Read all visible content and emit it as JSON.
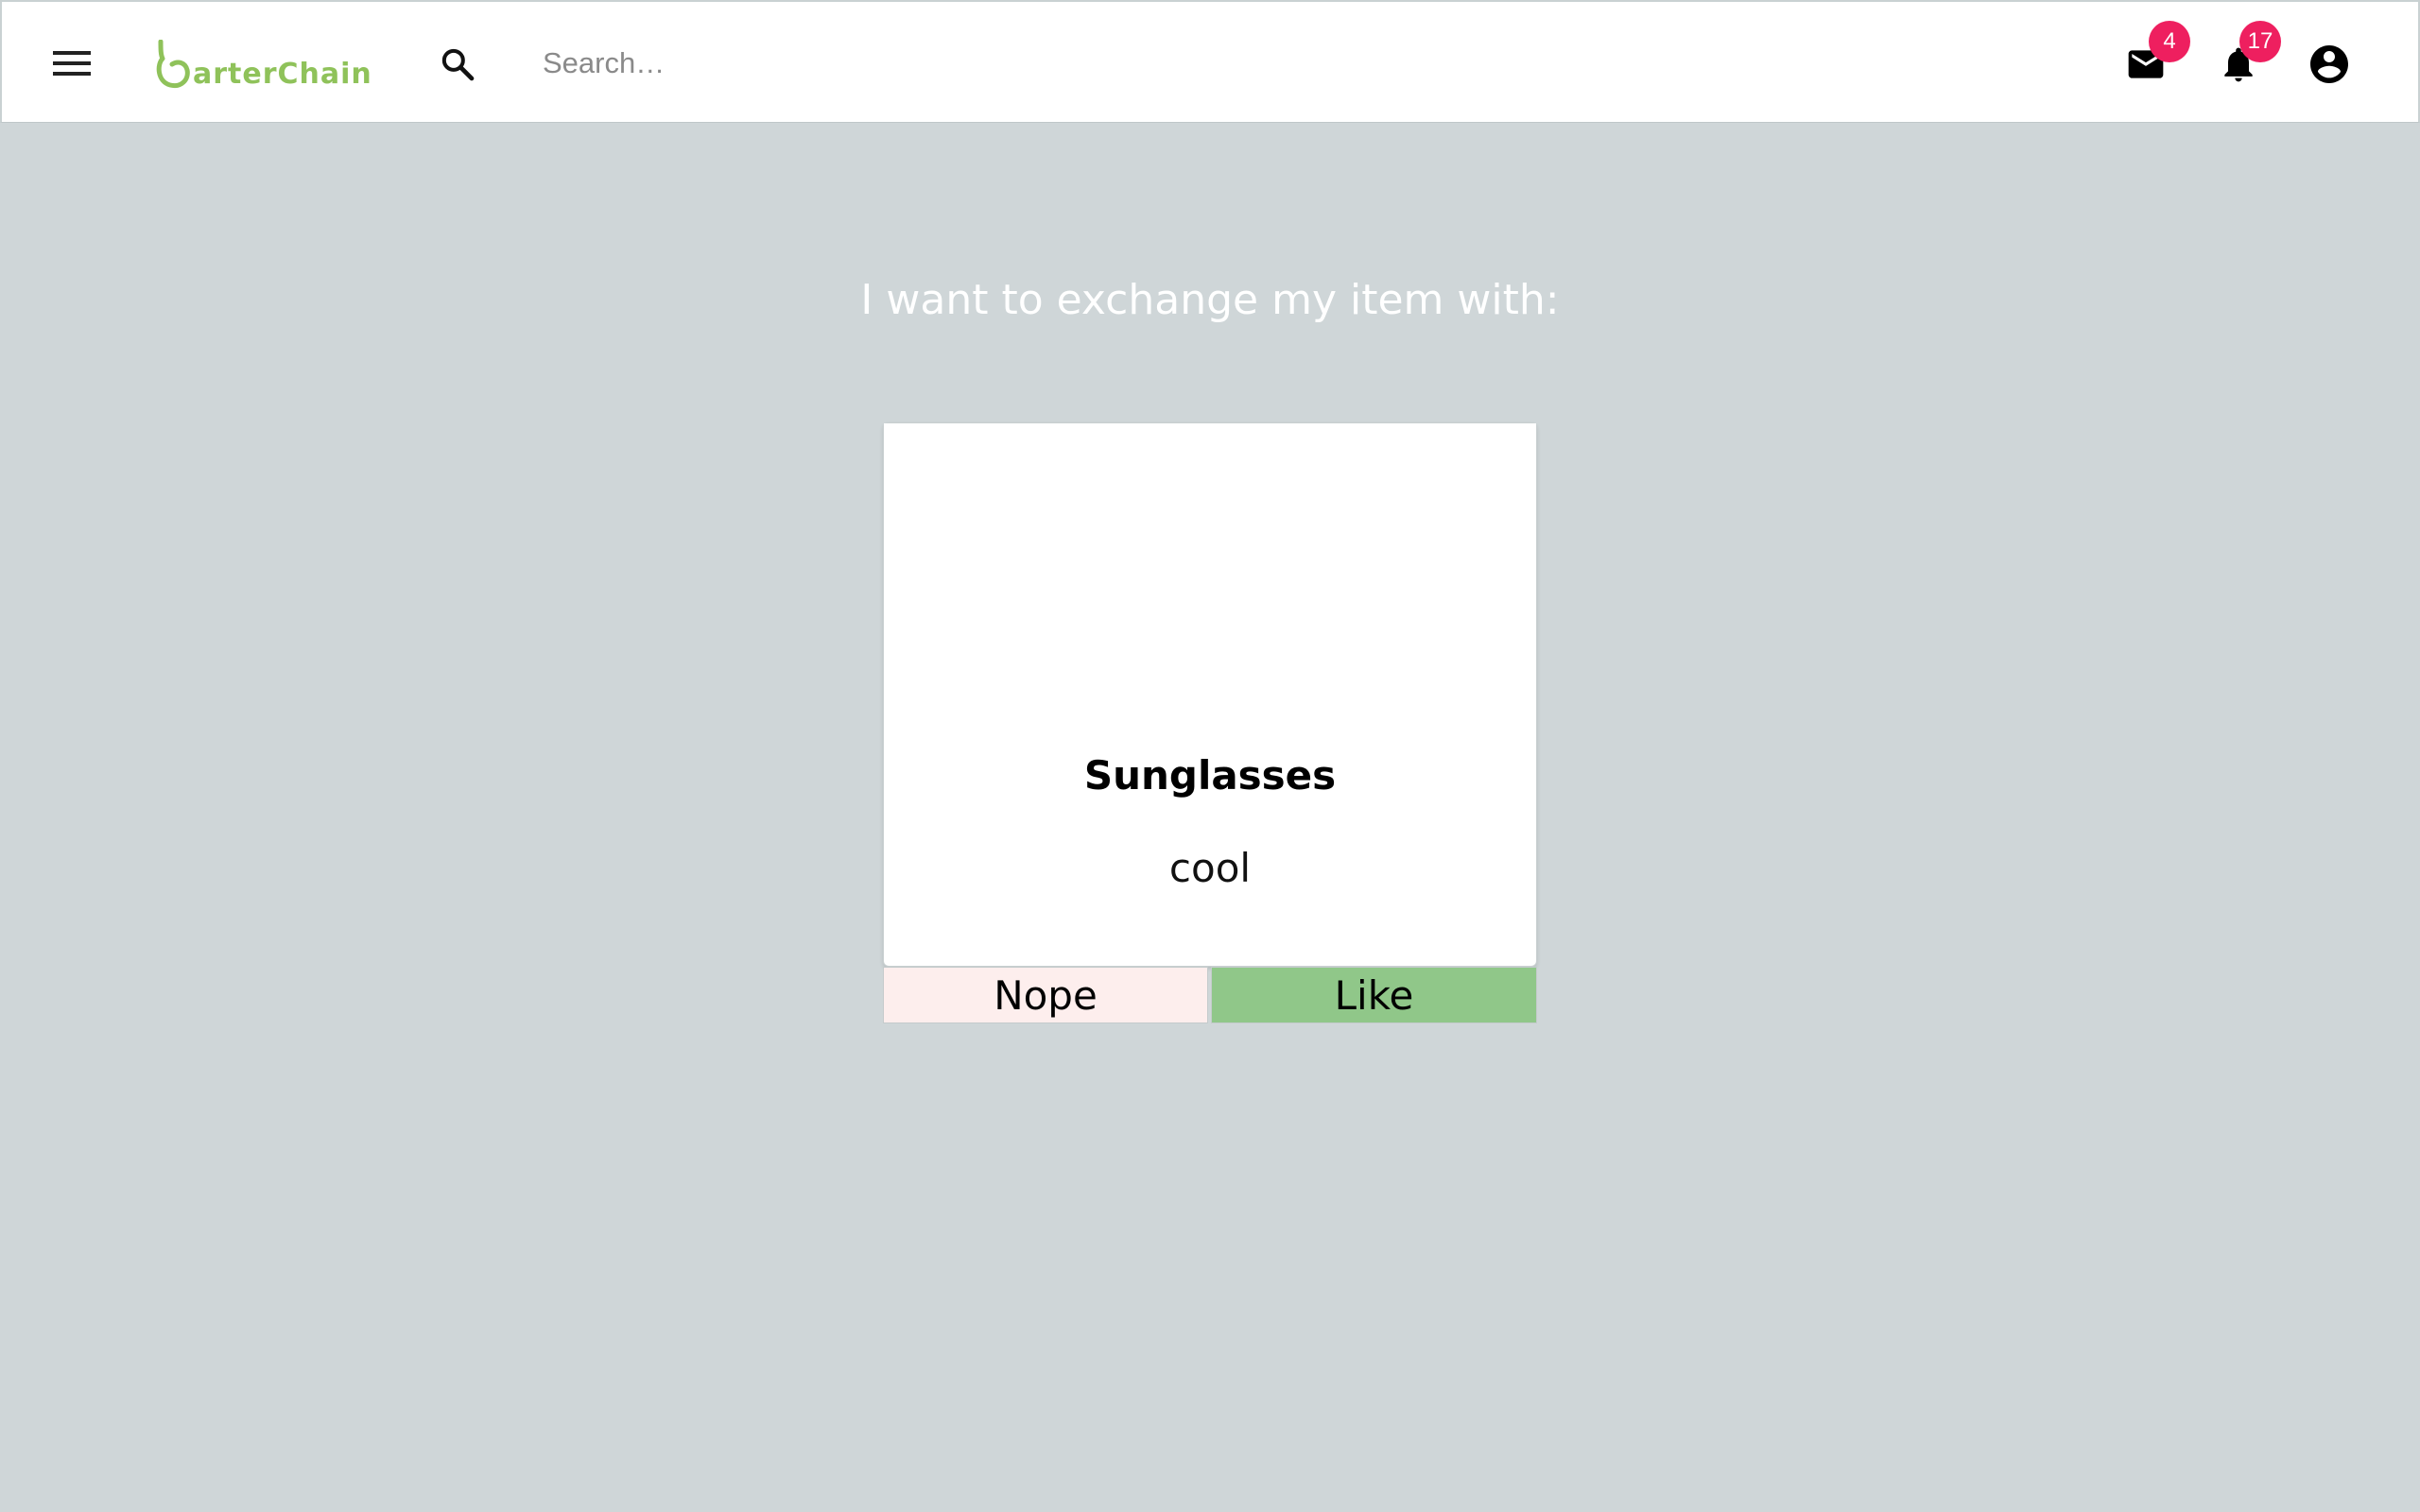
{
  "header": {
    "logo_text": "arterChain",
    "search_placeholder": "Search…",
    "mail_count": "4",
    "notification_count": "17"
  },
  "main": {
    "heading": "I want to exchange my item with:",
    "card": {
      "title": "Sunglasses",
      "description": "cool"
    },
    "actions": {
      "nope_label": "Nope",
      "like_label": "Like"
    }
  },
  "colors": {
    "brand_green": "#8fc25a",
    "badge_pink": "#ee1f5f",
    "like_green": "#90c789",
    "nope_pink": "#fdeeed",
    "background": "#cfd6d8"
  },
  "icons": {
    "menu": "menu-icon",
    "search": "search-icon",
    "mail": "mail-icon",
    "notifications": "bell-icon",
    "account": "account-circle-icon"
  }
}
